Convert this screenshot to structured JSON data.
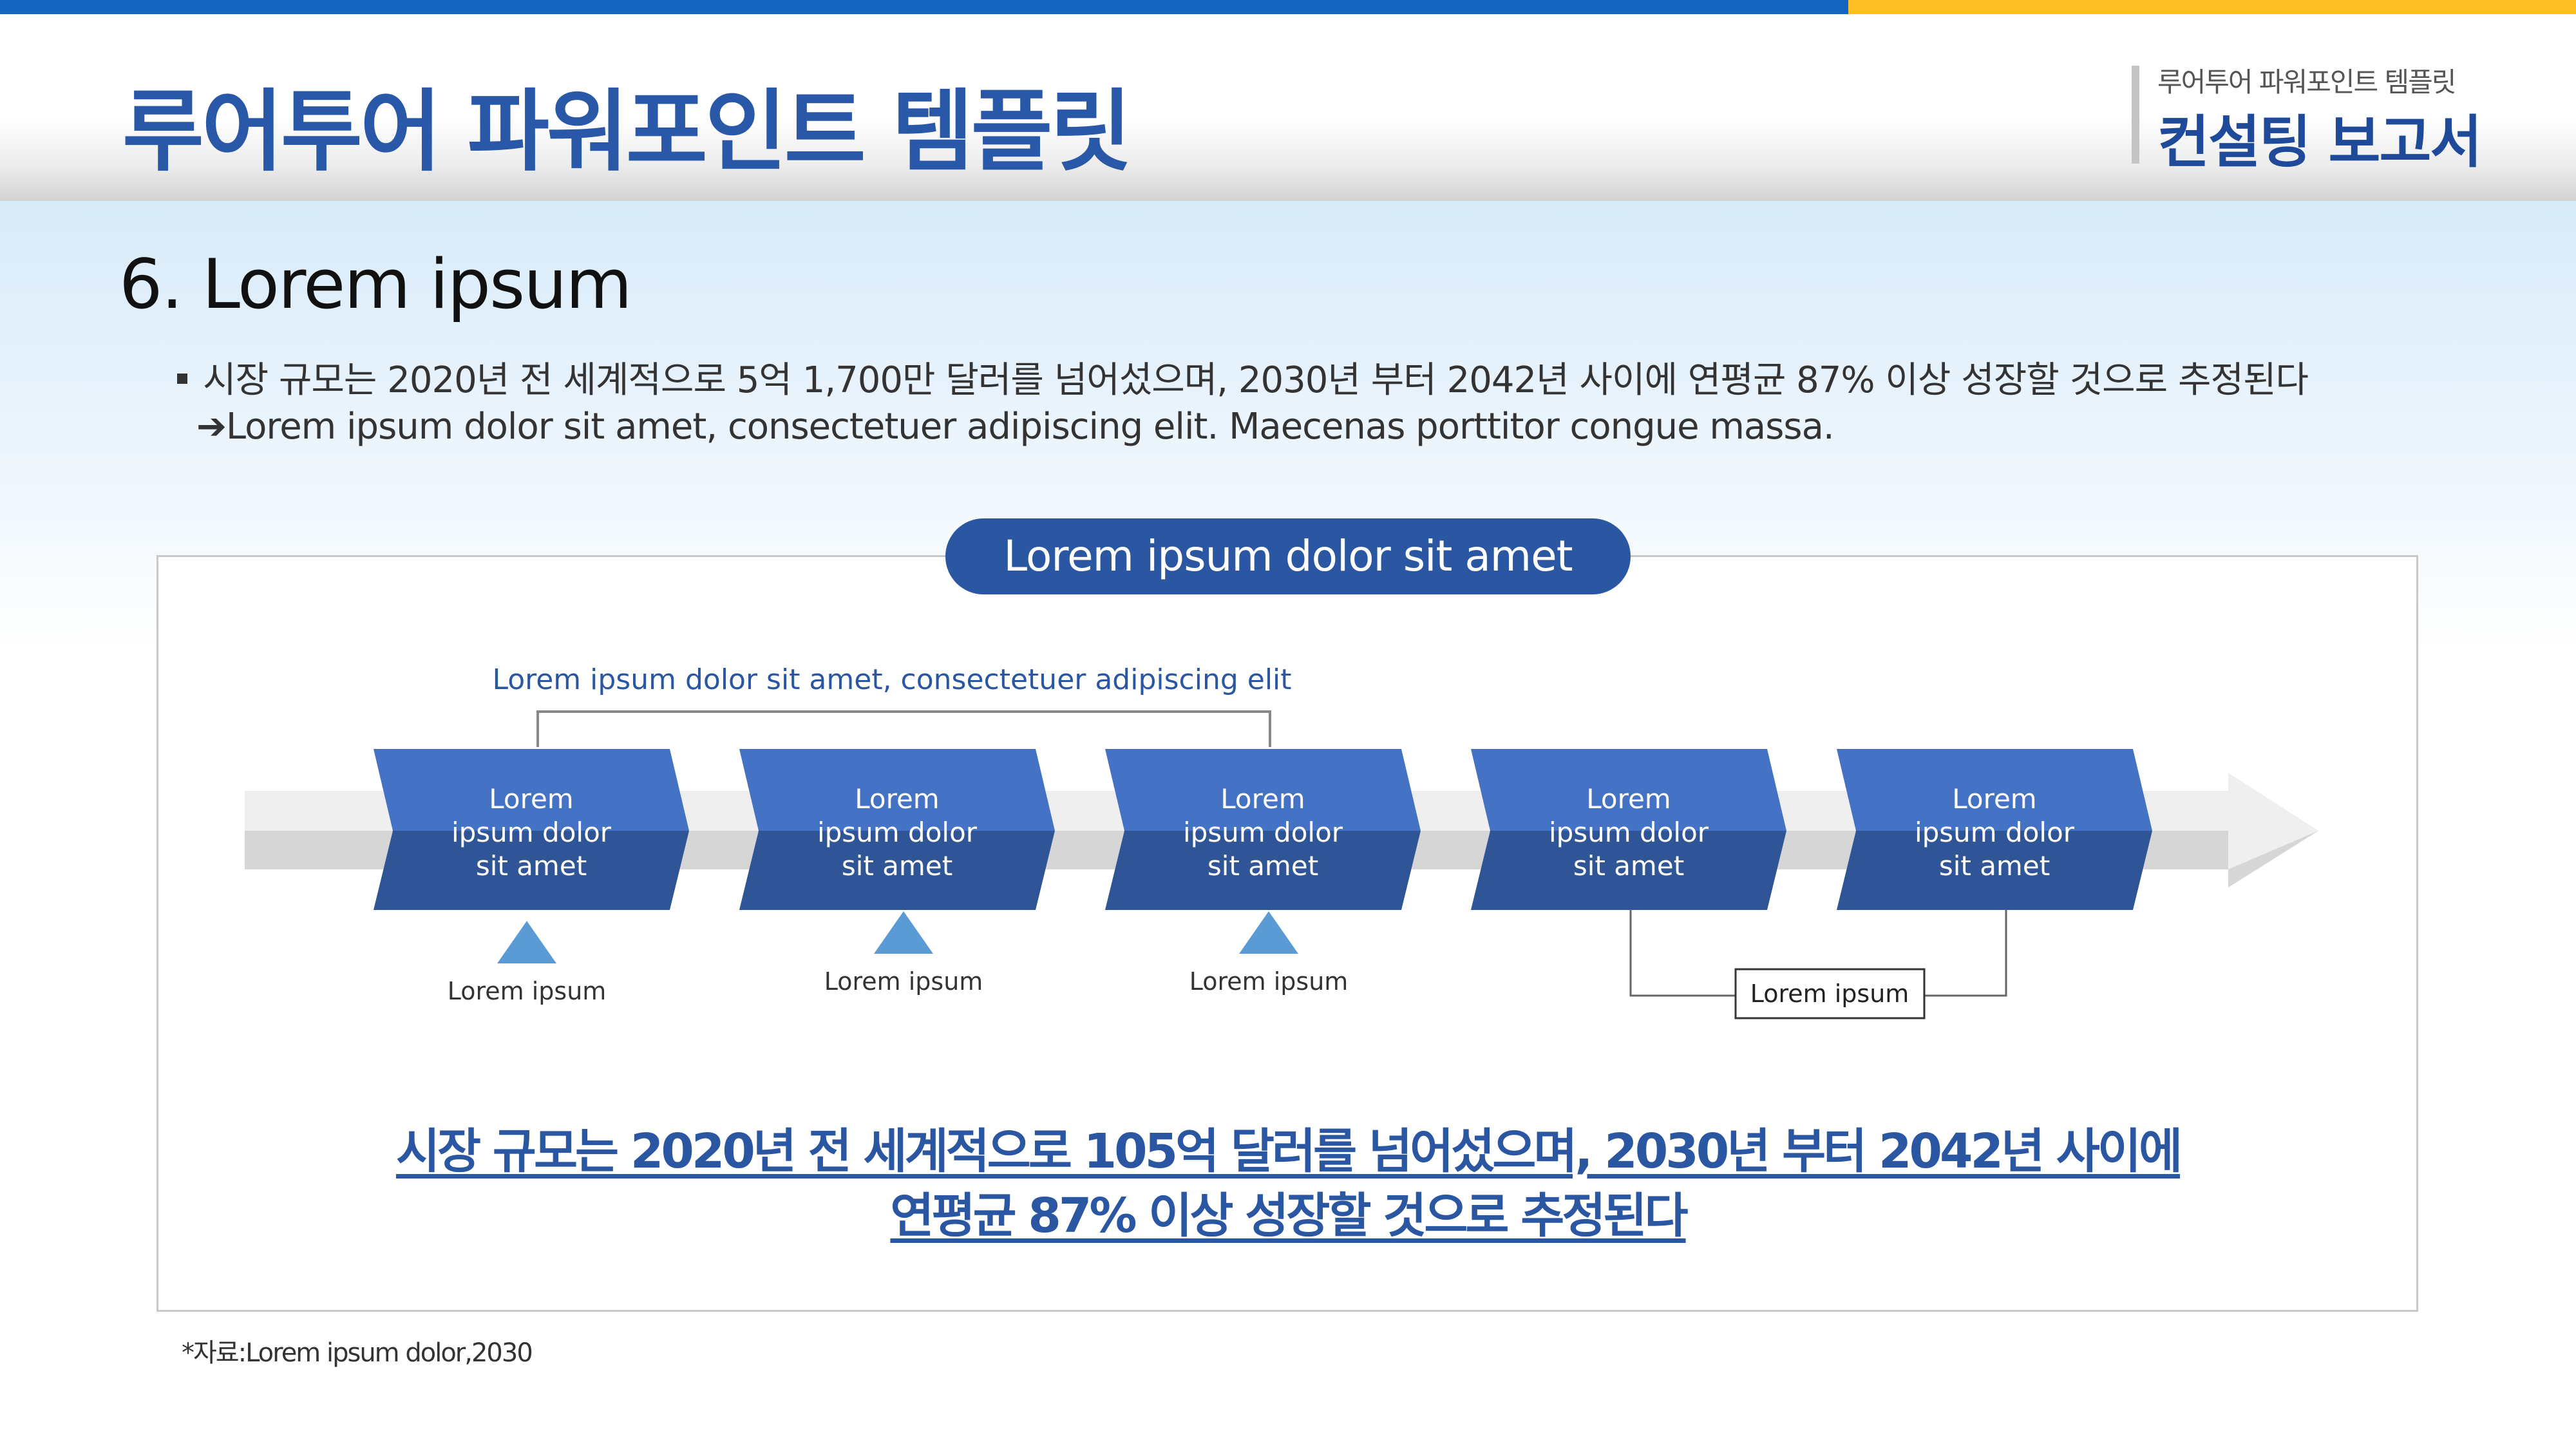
{
  "colors": {
    "accent_blue": "#1565c0",
    "accent_yellow": "#fbbf24",
    "title_blue": "#2a58a8",
    "box_light": "#4472c4",
    "box_dark": "#2f5597",
    "marker_blue": "#5b9bd5"
  },
  "header": {
    "title": "루어투어 파워포인트 템플릿",
    "subtitle_small": "루어투어 파워포인트 템플릿",
    "subtitle_big": "컨설팅 보고서"
  },
  "section": {
    "title": "6. Lorem ipsum",
    "bullet": "시장 규모는 2020년 전 세계적으로 5억 1,700만 달러를 넘어섰으며, 2030년 부터 2042년 사이에 연평균 87% 이상 성장할 것으로 추정된다",
    "arrow_line": "➔Lorem ipsum dolor sit amet, consectetuer adipiscing elit. Maecenas porttitor congue massa."
  },
  "panel": {
    "pill_label": "Lorem ipsum dolor sit amet",
    "bracket_label": "Lorem ipsum dolor sit amet, consectetuer adipiscing elit",
    "steps": [
      {
        "line1": "Lorem",
        "line2": "ipsum dolor",
        "line3": "sit amet"
      },
      {
        "line1": "Lorem",
        "line2": "ipsum dolor",
        "line3": "sit amet"
      },
      {
        "line1": "Lorem",
        "line2": "ipsum dolor",
        "line3": "sit amet"
      },
      {
        "line1": "Lorem",
        "line2": "ipsum dolor",
        "line3": "sit amet"
      },
      {
        "line1": "Lorem",
        "line2": "ipsum dolor",
        "line3": "sit amet"
      }
    ],
    "markers": [
      {
        "label": "Lorem ipsum"
      },
      {
        "label": "Lorem ipsum"
      },
      {
        "label": "Lorem ipsum"
      }
    ],
    "connector_label": "Lorem ipsum",
    "bottom_line1": "시장 규모는 2020년 전 세계적으로 105억 달러를 넘어섰으며, 2030년 부터 2042년 사이에",
    "bottom_line2": "연평균 87% 이상 성장할 것으로 추정된다"
  },
  "footer": {
    "source": "*자료:Lorem ipsum dolor,2030"
  }
}
